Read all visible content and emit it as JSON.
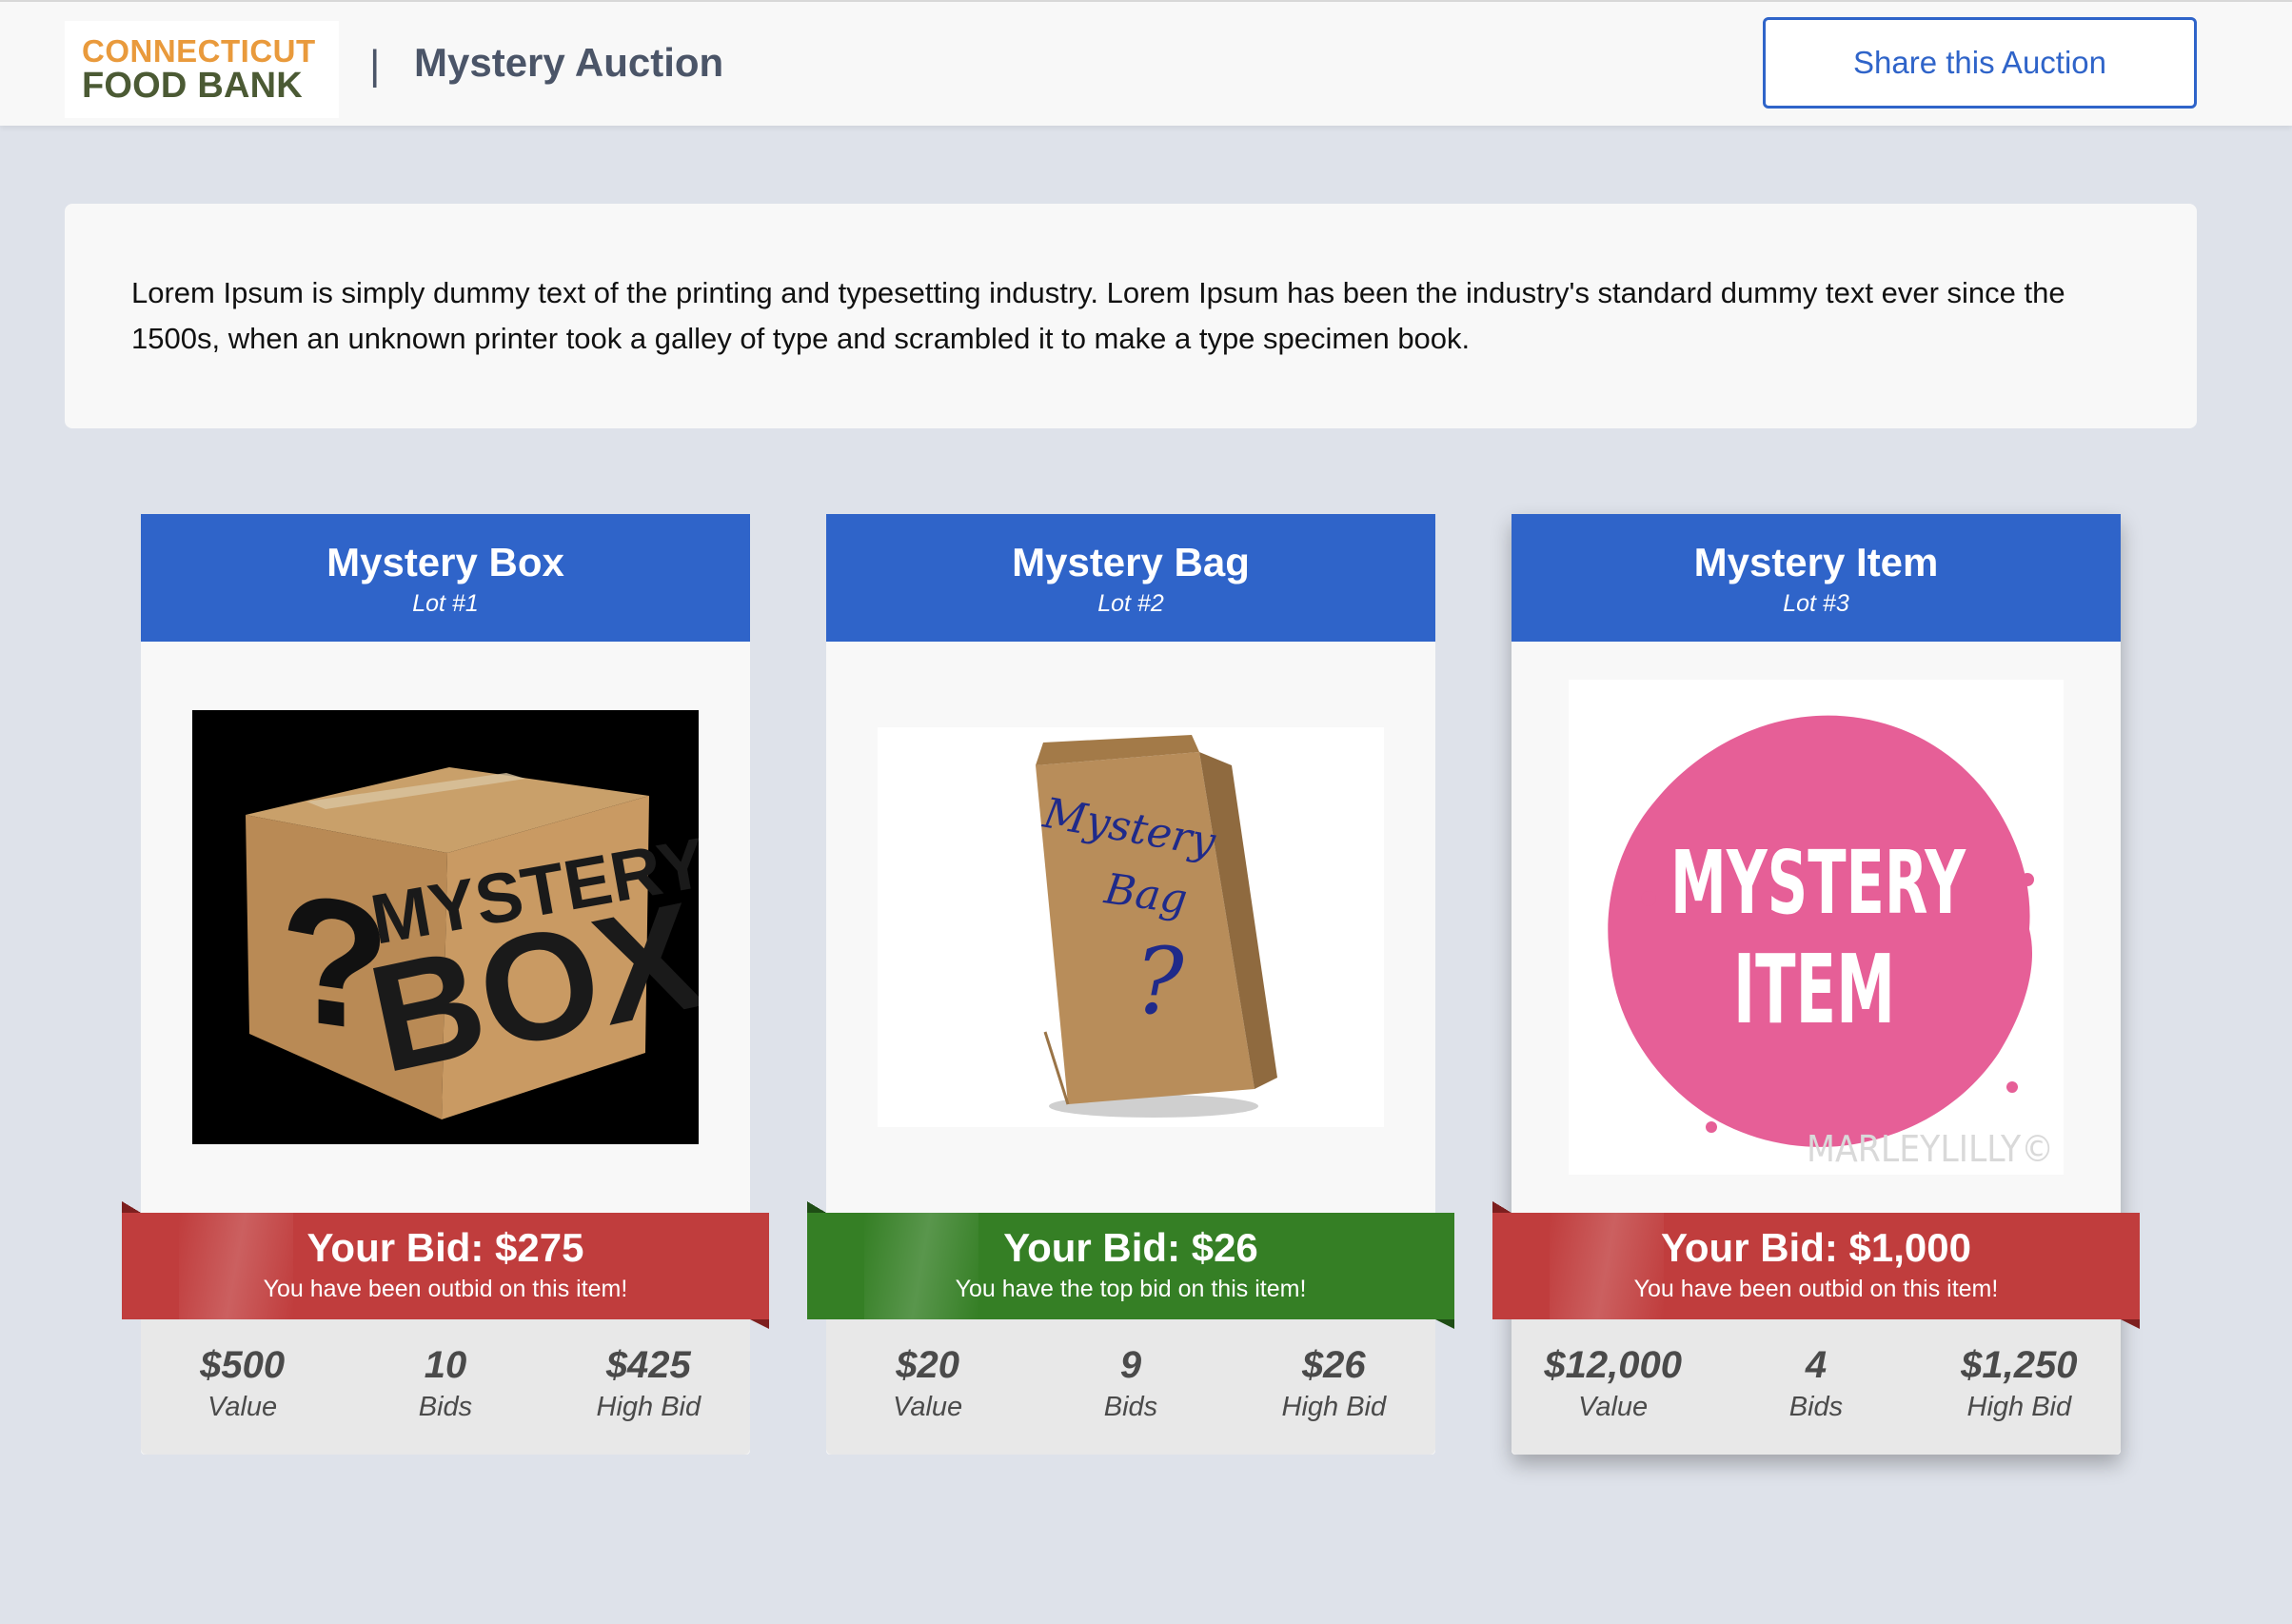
{
  "header": {
    "logo_line1": "CONNECTICUT",
    "logo_line2": "FOOD BANK",
    "separator": "|",
    "title": "Mystery Auction",
    "share_label": "Share this Auction"
  },
  "description": "Lorem Ipsum is simply dummy text of the printing and typesetting industry. Lorem Ipsum has been the industry's standard dummy text ever since the 1500s, when an unknown printer took a galley of type and scrambled it to make a type specimen book.",
  "lots": [
    {
      "title": "Mystery Box",
      "lot": "Lot #1",
      "image_icon": "mystery-box-image",
      "image_text_1": "MYSTERY",
      "image_text_2": "BOX",
      "your_bid": "Your Bid: $275",
      "bid_status": "You have been outbid on this item!",
      "status_color": "#c03d3d",
      "value": "$500",
      "value_label": "Value",
      "bids": "10",
      "bids_label": "Bids",
      "high_bid": "$425",
      "high_bid_label": "High Bid"
    },
    {
      "title": "Mystery Bag",
      "lot": "Lot #2",
      "image_icon": "mystery-bag-image",
      "image_text_1": "Mystery",
      "image_text_2": "Bag",
      "your_bid": "Your Bid: $26",
      "bid_status": "You have the top bid on this item!",
      "status_color": "#357f25",
      "value": "$20",
      "value_label": "Value",
      "bids": "9",
      "bids_label": "Bids",
      "high_bid": "$26",
      "high_bid_label": "High Bid"
    },
    {
      "title": "Mystery Item",
      "lot": "Lot #3",
      "image_icon": "mystery-item-image",
      "image_text_1": "MYSTERY",
      "image_text_2": "ITEM",
      "image_watermark": "MARLEYLILLY©",
      "your_bid": "Your Bid: $1,000",
      "bid_status": "You have been outbid on this item!",
      "status_color": "#c03d3d",
      "value": "$12,000",
      "value_label": "Value",
      "bids": "4",
      "bids_label": "Bids",
      "high_bid": "$1,250",
      "high_bid_label": "High Bid"
    }
  ]
}
